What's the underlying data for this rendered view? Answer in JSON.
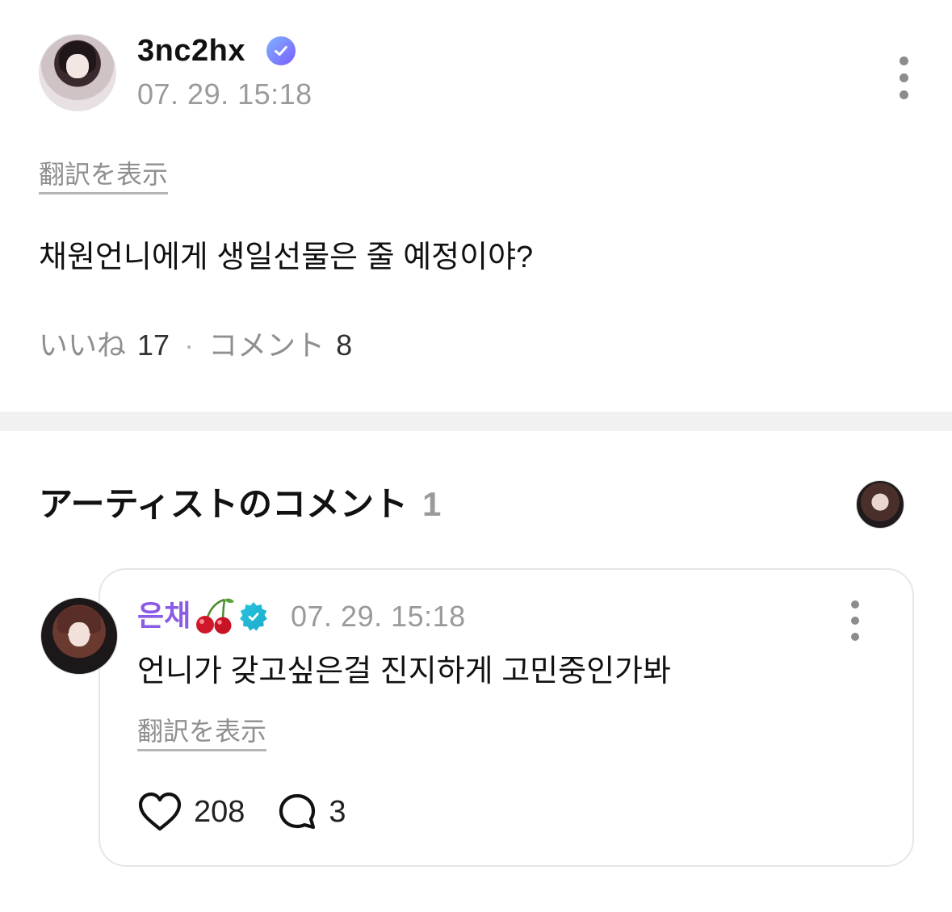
{
  "post": {
    "username": "3nc2hx",
    "timestamp": "07. 29. 15:18",
    "translate_label": "翻訳を表示",
    "body": "채원언니에게 생일선물은 줄 예정이야?",
    "likes_label": "いいね",
    "likes_count": "17",
    "separator": "·",
    "comments_label": "コメント",
    "comments_count": "8"
  },
  "artist_section": {
    "title": "アーティストのコメント",
    "count": "1"
  },
  "artist_comment": {
    "author": "은채",
    "timestamp": "07. 29. 15:18",
    "text": "언니가 갖고싶은걸 진지하게 고민중인가봐",
    "translate_label": "翻訳を表示",
    "likes": "208",
    "replies": "3"
  },
  "colors": {
    "author_purple": "#8a5ce6",
    "verified_blue": "#7a5cff",
    "artist_verified": "#1aa9c9",
    "muted": "#9a9a9a"
  },
  "icons": [
    "verified-badge-icon",
    "more-options-icon",
    "cherry-icon",
    "heart-icon",
    "comment-bubble-icon"
  ]
}
